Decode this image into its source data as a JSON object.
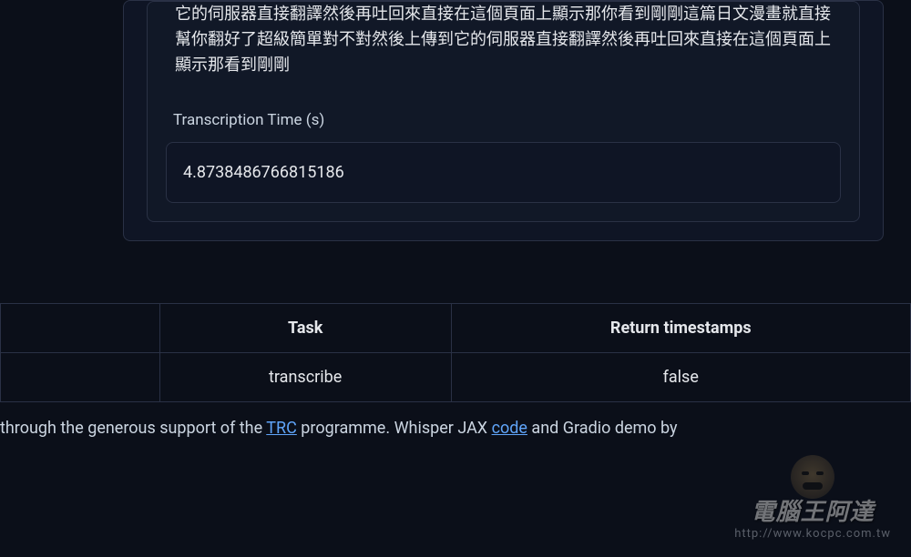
{
  "output": {
    "transcription_text": "它的伺服器直接翻譯然後再吐回來直接在這個頁面上顯示那你看到剛剛這篇日文漫畫就直接幫你翻好了超級簡單對不對然後上傳到它的伺服器直接翻譯然後再吐回來直接在這個頁面上顯示那看到剛剛",
    "time_label": "Transcription Time (s)",
    "time_value": "4.8738486766815186"
  },
  "table": {
    "headers": {
      "col1": "",
      "col2": "Task",
      "col3": "Return timestamps"
    },
    "row": {
      "col1": "",
      "col2": "transcribe",
      "col3": "false"
    }
  },
  "footer": {
    "prefix": "through the generous support of the ",
    "link1_label": "TRC",
    "mid": " programme. Whisper JAX ",
    "link2_label": "code",
    "suffix": " and Gradio demo by"
  },
  "watermark": {
    "title": "電腦王阿達",
    "url": "http://www.kocpc.com.tw"
  }
}
